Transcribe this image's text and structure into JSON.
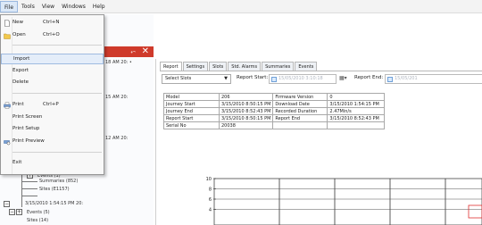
{
  "menubar": [
    "File",
    "Tools",
    "View",
    "Windows",
    "Help"
  ],
  "file_menu": {
    "items": [
      {
        "label": "New",
        "shortcut": "Ctrl+N",
        "icon": "new-document-icon"
      },
      {
        "label": "Open",
        "shortcut": "Ctrl+O",
        "icon": "open-folder-icon"
      },
      {
        "label": "Import",
        "shortcut": "",
        "highlighted": true
      },
      {
        "label": "Export",
        "shortcut": ""
      },
      {
        "label": "Delete",
        "shortcut": ""
      },
      {
        "label": "Print",
        "shortcut": "Ctrl+P",
        "icon": "printer-icon"
      },
      {
        "label": "Print Screen",
        "shortcut": ""
      },
      {
        "label": "Print Setup",
        "shortcut": ""
      },
      {
        "label": "Print Preview",
        "shortcut": "",
        "icon": "print-preview-icon"
      },
      {
        "label": "Exit",
        "shortcut": ""
      }
    ]
  },
  "left_pane": {
    "pin_glyph": "⬿",
    "close_glyph": "✕",
    "timestamps": [
      "18 AM 20: •",
      "15 AM 20:",
      "12 AM 20:"
    ],
    "tree": {
      "events": "Events (1)",
      "summaries": "Summaries (852)",
      "sites": "Sites (E1157)",
      "journey": "3/15/2010 1:54:15 PM 20:",
      "events2": "Events (5)",
      "sites2": "Sites (14)"
    }
  },
  "tabs": [
    "Report",
    "Settings",
    "Slots",
    "Std. Alarms",
    "Summaries",
    "Events"
  ],
  "toolbar": {
    "select_sites": "Select Slots",
    "report_start_label": "Report Start:",
    "report_start_value": "15/05/2010 3:10:18",
    "report_end_label": "Report End:",
    "report_end_value": "15/05/201"
  },
  "info_table": [
    [
      "Model",
      "206",
      "Firmware Version",
      "0"
    ],
    [
      "Journey Start",
      "3/15/2010 8:50:15 PM",
      "Download Date",
      "3/15/2010 1:54:15 PM"
    ],
    [
      "Journey End",
      "3/15/2010 8:52:43 PM",
      "Recorded Duration",
      "2.47Min/s"
    ],
    [
      "Report Start",
      "3/15/2010 8:50:15 PM",
      "Report End",
      "3/15/2010 8:52:43 PM"
    ],
    [
      "Serial No",
      "20038",
      "",
      ""
    ]
  ],
  "chart_data": {
    "type": "line",
    "ylabel": "",
    "yticks": [
      "10",
      "8",
      "6",
      "4"
    ],
    "ylim": [
      4,
      10
    ],
    "series": []
  }
}
